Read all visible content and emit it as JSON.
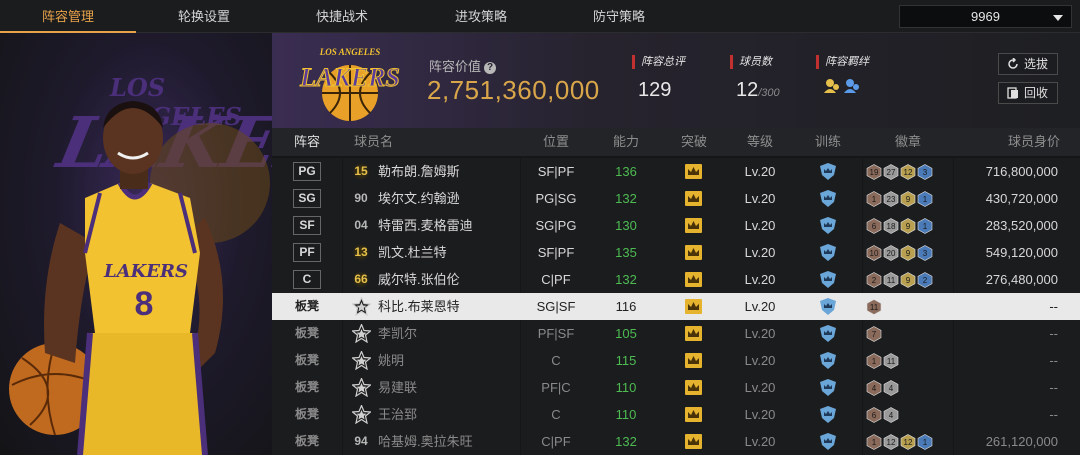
{
  "nav": {
    "tabs": [
      "阵容管理",
      "轮换设置",
      "快捷战术",
      "进攻策略",
      "防守策略"
    ],
    "active_tab": 0,
    "dropdown_value": "9969"
  },
  "header": {
    "value_label": "阵容价值",
    "value": "2,751,360,000",
    "logo_text": "LAKERS",
    "logo_arc_text": "LOS ANGELES",
    "stats": [
      {
        "label": "阵容总评",
        "value": "129",
        "sub": ""
      },
      {
        "label": "球员数",
        "value": "12",
        "sub": "/300"
      },
      {
        "label": "阵容羁绊",
        "value": "",
        "sub": ""
      }
    ],
    "buttons": [
      {
        "label": "选拔",
        "icon": "refresh-icon"
      },
      {
        "label": "回收",
        "icon": "recycle-icon"
      }
    ]
  },
  "portrait": {
    "bg_text_1": "LOS ANGELES",
    "bg_text_2": "LAKERS",
    "jersey_text": "LAKERS",
    "jersey_number": "8"
  },
  "table": {
    "columns": [
      "阵容",
      "球员名",
      "位置",
      "能力",
      "突破",
      "等级",
      "训练",
      "徽章",
      "球员身价"
    ],
    "rows": [
      {
        "slot": "PG",
        "tag": "15",
        "tag_style": "gold",
        "name": "勒布朗.詹姆斯",
        "position": "SF|PF",
        "ability": "136",
        "level": "Lv.20",
        "badges": [
          {
            "n": "19",
            "c": "#8a6a5a"
          },
          {
            "n": "27",
            "c": "#9a9a9a"
          },
          {
            "n": "12",
            "c": "#b8a050"
          },
          {
            "n": "3",
            "c": "#4a7ab8"
          }
        ],
        "salary": "716,800,000",
        "starter": true,
        "selected": false
      },
      {
        "slot": "SG",
        "tag": "90",
        "tag_style": "plain",
        "name": "埃尔文.约翰逊",
        "position": "PG|SG",
        "ability": "132",
        "level": "Lv.20",
        "badges": [
          {
            "n": "1",
            "c": "#8a6a5a"
          },
          {
            "n": "23",
            "c": "#9a9a9a"
          },
          {
            "n": "9",
            "c": "#b8a050"
          },
          {
            "n": "1",
            "c": "#4a7ab8"
          }
        ],
        "salary": "430,720,000",
        "starter": true,
        "selected": false
      },
      {
        "slot": "SF",
        "tag": "04",
        "tag_style": "plain",
        "name": "特雷西.麦格雷迪",
        "position": "SG|PG",
        "ability": "130",
        "level": "Lv.20",
        "badges": [
          {
            "n": "6",
            "c": "#8a6a5a"
          },
          {
            "n": "18",
            "c": "#9a9a9a"
          },
          {
            "n": "9",
            "c": "#b8a050"
          },
          {
            "n": "1",
            "c": "#4a7ab8"
          }
        ],
        "salary": "283,520,000",
        "starter": true,
        "selected": false
      },
      {
        "slot": "PF",
        "tag": "13",
        "tag_style": "gold",
        "name": "凯文.杜兰特",
        "position": "SF|PF",
        "ability": "135",
        "level": "Lv.20",
        "badges": [
          {
            "n": "10",
            "c": "#8a6a5a"
          },
          {
            "n": "20",
            "c": "#9a9a9a"
          },
          {
            "n": "9",
            "c": "#b8a050"
          },
          {
            "n": "3",
            "c": "#4a7ab8"
          }
        ],
        "salary": "549,120,000",
        "starter": true,
        "selected": false
      },
      {
        "slot": "C",
        "tag": "66",
        "tag_style": "gold",
        "name": "威尔特.张伯伦",
        "position": "C|PF",
        "ability": "132",
        "level": "Lv.20",
        "badges": [
          {
            "n": "2",
            "c": "#8a6a5a"
          },
          {
            "n": "11",
            "c": "#9a9a9a"
          },
          {
            "n": "9",
            "c": "#b8a050"
          },
          {
            "n": "2",
            "c": "#4a7ab8"
          }
        ],
        "salary": "276,480,000",
        "starter": true,
        "selected": false
      },
      {
        "slot": "板凳",
        "tag": "",
        "tag_style": "star",
        "name": "科比.布莱恩特",
        "position": "SG|SF",
        "ability": "116",
        "level": "Lv.20",
        "badges": [
          {
            "n": "11",
            "c": "#8a6a5a"
          }
        ],
        "salary": "--",
        "starter": false,
        "selected": true
      },
      {
        "slot": "板凳",
        "tag": "",
        "tag_style": "star",
        "name": "李凯尔",
        "position": "PF|SF",
        "ability": "105",
        "level": "Lv.20",
        "badges": [
          {
            "n": "7",
            "c": "#8a6a5a"
          }
        ],
        "salary": "--",
        "starter": false,
        "selected": false
      },
      {
        "slot": "板凳",
        "tag": "",
        "tag_style": "star",
        "name": "姚明",
        "position": "C",
        "ability": "115",
        "level": "Lv.20",
        "badges": [
          {
            "n": "1",
            "c": "#8a6a5a"
          },
          {
            "n": "11",
            "c": "#9a9a9a"
          }
        ],
        "salary": "--",
        "starter": false,
        "selected": false
      },
      {
        "slot": "板凳",
        "tag": "",
        "tag_style": "star",
        "name": "易建联",
        "position": "PF|C",
        "ability": "110",
        "level": "Lv.20",
        "badges": [
          {
            "n": "4",
            "c": "#8a6a5a"
          },
          {
            "n": "4",
            "c": "#9a9a9a"
          }
        ],
        "salary": "--",
        "starter": false,
        "selected": false
      },
      {
        "slot": "板凳",
        "tag": "",
        "tag_style": "star",
        "name": "王治郅",
        "position": "C",
        "ability": "110",
        "level": "Lv.20",
        "badges": [
          {
            "n": "6",
            "c": "#8a6a5a"
          },
          {
            "n": "4",
            "c": "#9a9a9a"
          }
        ],
        "salary": "--",
        "starter": false,
        "selected": false
      },
      {
        "slot": "板凳",
        "tag": "94",
        "tag_style": "plain",
        "name": "哈基姆.奥拉朱旺",
        "position": "C|PF",
        "ability": "132",
        "level": "Lv.20",
        "badges": [
          {
            "n": "1",
            "c": "#8a6a5a"
          },
          {
            "n": "12",
            "c": "#9a9a9a"
          },
          {
            "n": "12",
            "c": "#b8a050"
          },
          {
            "n": "1",
            "c": "#4a7ab8"
          }
        ],
        "salary": "261,120,000",
        "starter": false,
        "selected": false
      }
    ]
  },
  "colors": {
    "accent": "#e8a24a",
    "value_gold": "#d9a64a",
    "ability_green": "#4dbb52",
    "lakers_purple": "#4b2f7a",
    "lakers_gold": "#f2c230"
  }
}
